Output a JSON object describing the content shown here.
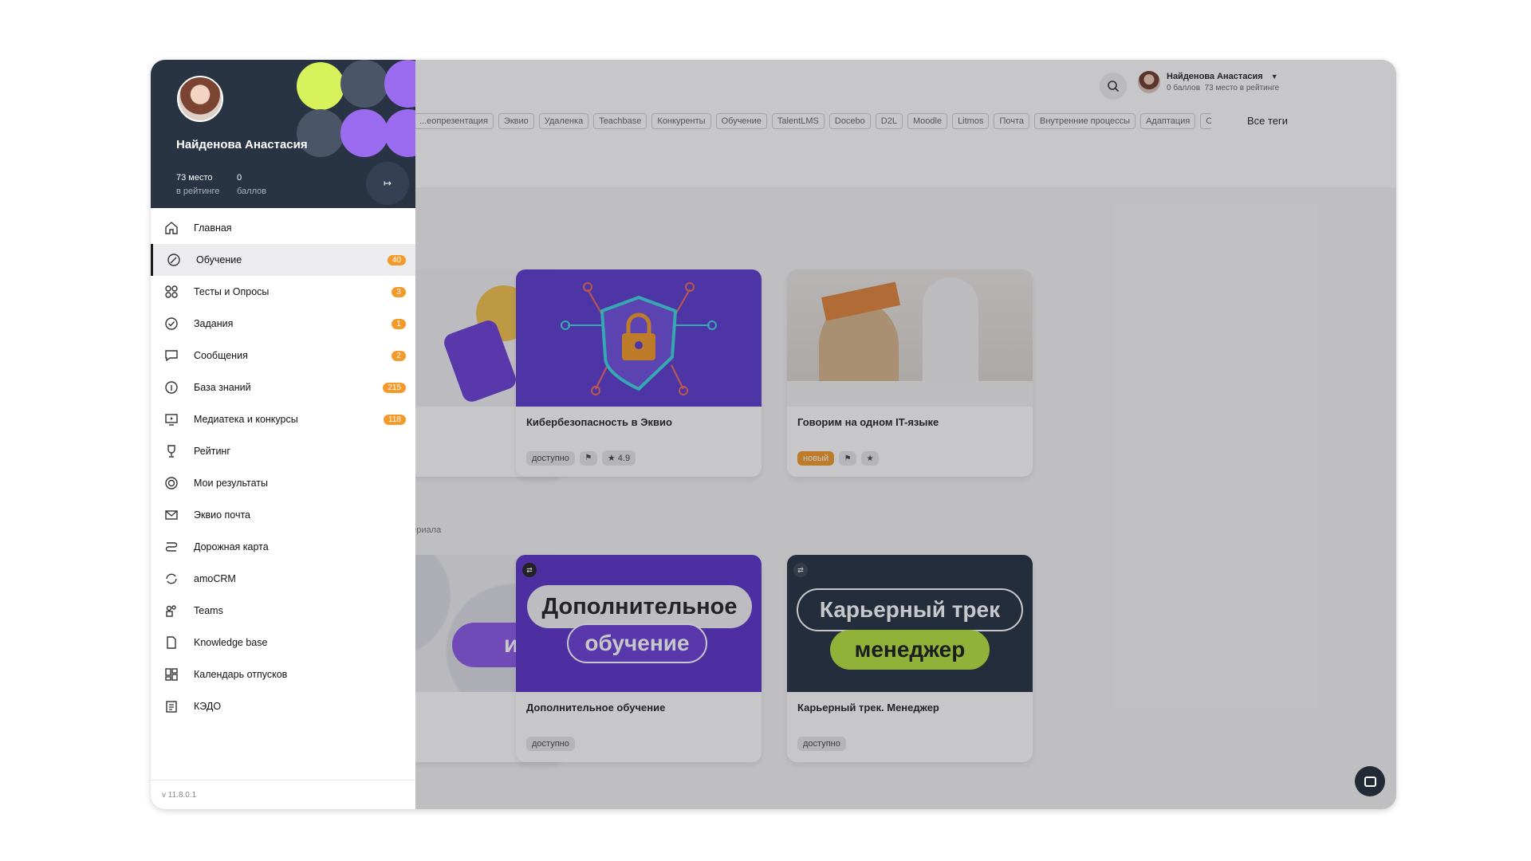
{
  "header": {
    "user_name": "Найденова Анастасия",
    "user_points": "0 баллов",
    "user_rank": "73 место в рейтинге"
  },
  "tags": [
    "...еопрезентация",
    "Эквио",
    "Удаленка",
    "Teachbase",
    "Конкуренты",
    "Обучение",
    "TalentLMS",
    "Docebo",
    "D2L",
    "Moodle",
    "Litmos",
    "Почта",
    "Внутренние процессы",
    "Адаптация",
    "Об..."
  ],
  "all_tags_label": "Все теги",
  "section_note": "...ериала",
  "cards": [
    {
      "title": "Кибербезопасность в Эквио",
      "badge": "доступно",
      "rating": "★ 4.9"
    },
    {
      "title": "Говорим на одном IT-языке",
      "badge": "новый",
      "rating": "★"
    },
    {
      "title": "Дополнительное обучение",
      "badge": "доступно",
      "image_text_1": "Дополнительное",
      "image_text_2": "обучение"
    },
    {
      "title": "Карьерный трек. Менеджер",
      "badge": "доступно",
      "image_text_1": "Карьерный трек",
      "image_text_2": "менеджер"
    }
  ],
  "partial_card": {
    "image_text": "ика"
  },
  "drawer": {
    "name": "Найденова Анастасия",
    "rank_value": "73 место",
    "rank_label": "в рейтинге",
    "points_value": "0",
    "points_label": "баллов",
    "version": "v 11.8.0.1",
    "items": [
      {
        "label": "Главная",
        "count": ""
      },
      {
        "label": "Обучение",
        "count": "40"
      },
      {
        "label": "Тесты и Опросы",
        "count": "3"
      },
      {
        "label": "Задания",
        "count": "1"
      },
      {
        "label": "Сообщения",
        "count": "2"
      },
      {
        "label": "База знаний",
        "count": "215"
      },
      {
        "label": "Медиатека и конкурсы",
        "count": "118"
      },
      {
        "label": "Рейтинг",
        "count": ""
      },
      {
        "label": "Мои результаты",
        "count": ""
      },
      {
        "label": "Эквио почта",
        "count": ""
      },
      {
        "label": "Дорожная карта",
        "count": ""
      },
      {
        "label": "amoCRM",
        "count": ""
      },
      {
        "label": "Teams",
        "count": ""
      },
      {
        "label": "Knowledge base",
        "count": ""
      },
      {
        "label": "Календарь отпусков",
        "count": ""
      },
      {
        "label": "КЭДО",
        "count": ""
      }
    ]
  },
  "colors": {
    "accent": "#f39a2a",
    "drawer_header": "#283343",
    "purple": "#6a3fd6",
    "lime": "#d7f25a"
  }
}
